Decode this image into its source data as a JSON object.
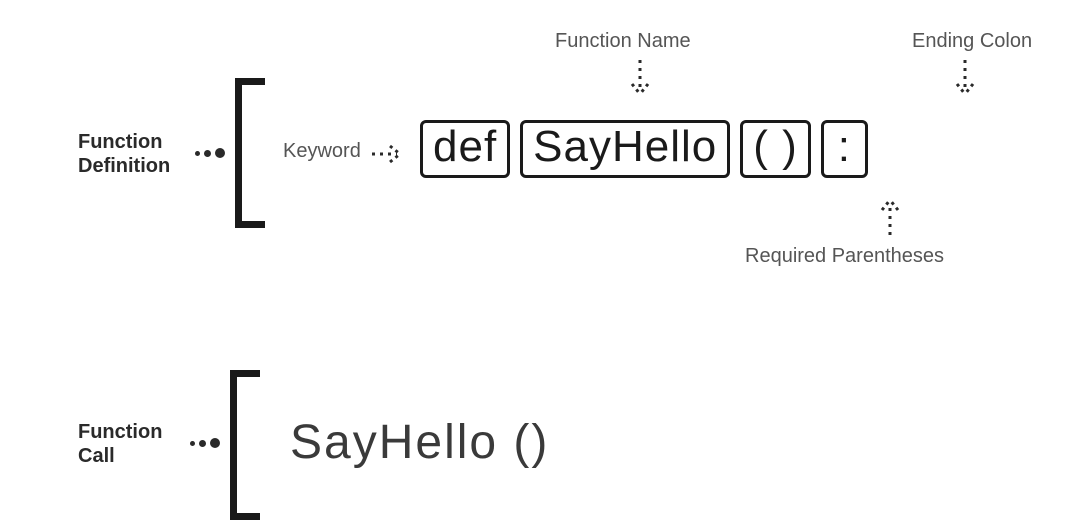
{
  "annotations": {
    "function_name": "Function Name",
    "ending_colon": "Ending Colon",
    "required_parentheses": "Required Parentheses",
    "keyword": "Keyword"
  },
  "sections": {
    "definition_line1": "Function",
    "definition_line2": "Definition",
    "call_line1": "Function",
    "call_line2": "Call"
  },
  "definition_tokens": {
    "def": "def",
    "name": "SayHello",
    "parens": "( )",
    "colon": ":"
  },
  "call_tokens": {
    "text": "SayHello ()"
  }
}
